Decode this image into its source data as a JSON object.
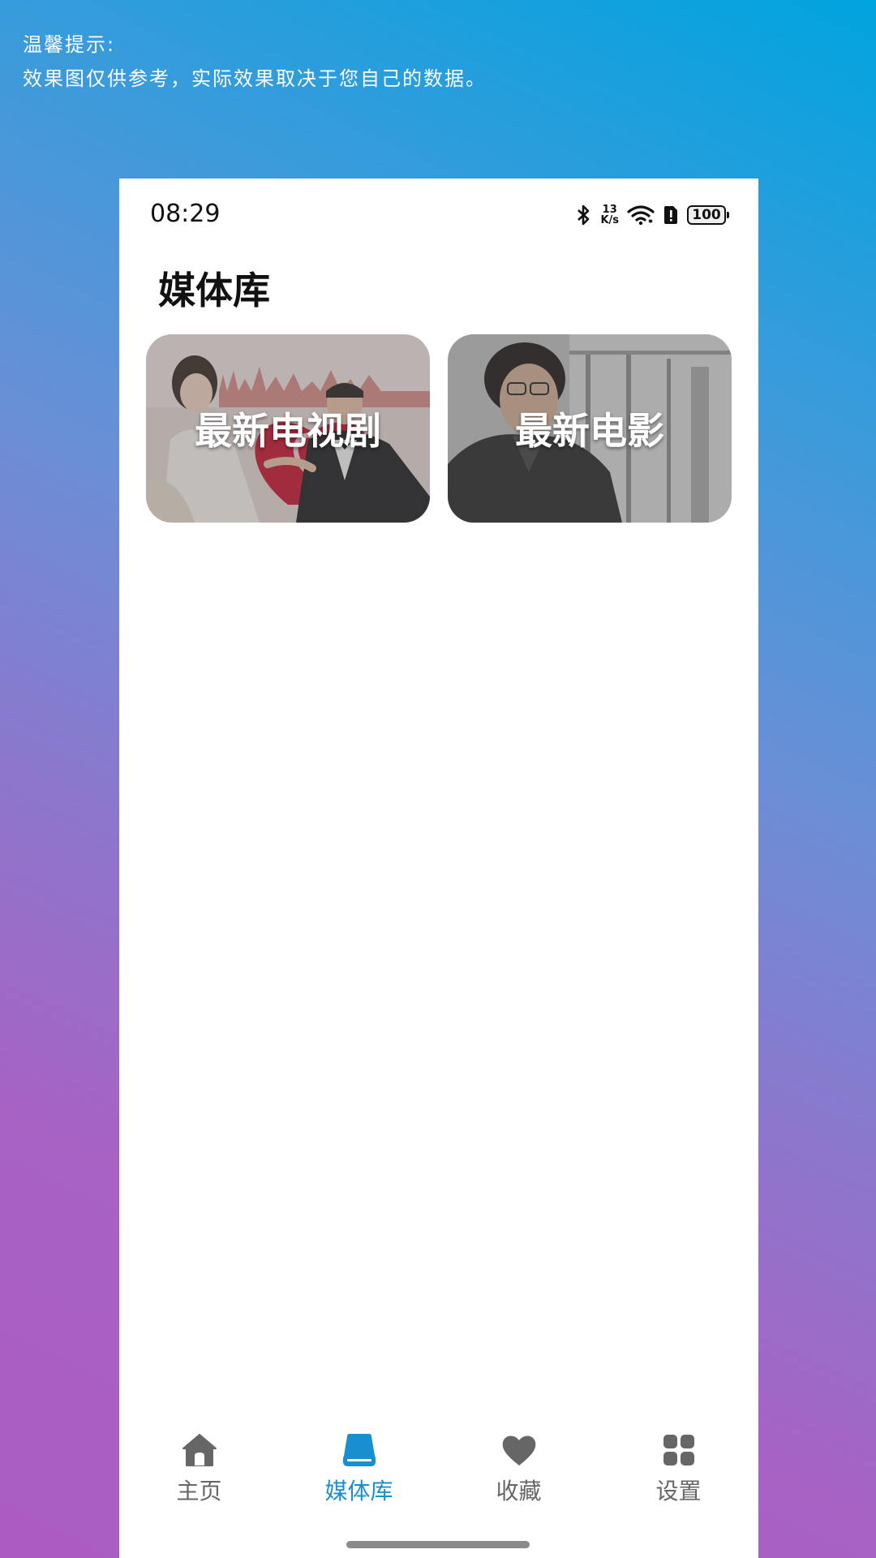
{
  "tip": {
    "title": "温馨提示:",
    "text": "效果图仅供参考，实际效果取决于您自己的数据。"
  },
  "status_bar": {
    "time": "08:29",
    "net_speed_value": "13",
    "net_speed_unit": "K/s",
    "battery": "100",
    "icons": [
      "bluetooth-icon",
      "wifi-icon",
      "sim-alert-icon",
      "battery-icon"
    ]
  },
  "page": {
    "title": "媒体库"
  },
  "cards": [
    {
      "label": "最新电视剧"
    },
    {
      "label": "最新电影"
    }
  ],
  "tabs": [
    {
      "label": "主页",
      "icon": "home-icon",
      "active": false
    },
    {
      "label": "媒体库",
      "icon": "drive-icon",
      "active": true
    },
    {
      "label": "收藏",
      "icon": "heart-icon",
      "active": false
    },
    {
      "label": "设置",
      "icon": "grid-icon",
      "active": false
    }
  ],
  "colors": {
    "accent": "#1a8fd0",
    "tab_inactive": "#666666",
    "background_top": "#00a4df",
    "background_bottom": "#ab5cc3"
  }
}
